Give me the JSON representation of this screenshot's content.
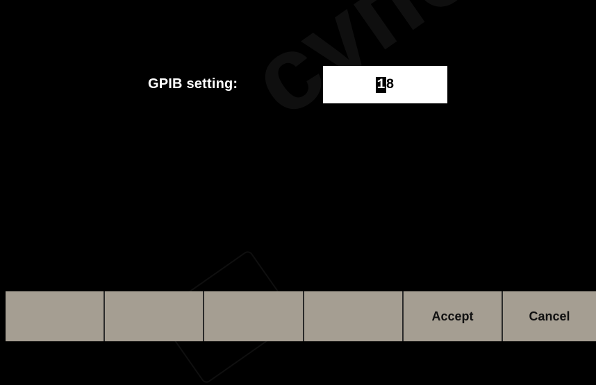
{
  "dialog": {
    "label": "GPIB setting:",
    "value_cursor_digit": "1",
    "value_rest": "8"
  },
  "softkeys": [
    {
      "label": ""
    },
    {
      "label": ""
    },
    {
      "label": ""
    },
    {
      "label": ""
    },
    {
      "label": "Accept"
    },
    {
      "label": "Cancel"
    }
  ],
  "watermark": "суперайс"
}
